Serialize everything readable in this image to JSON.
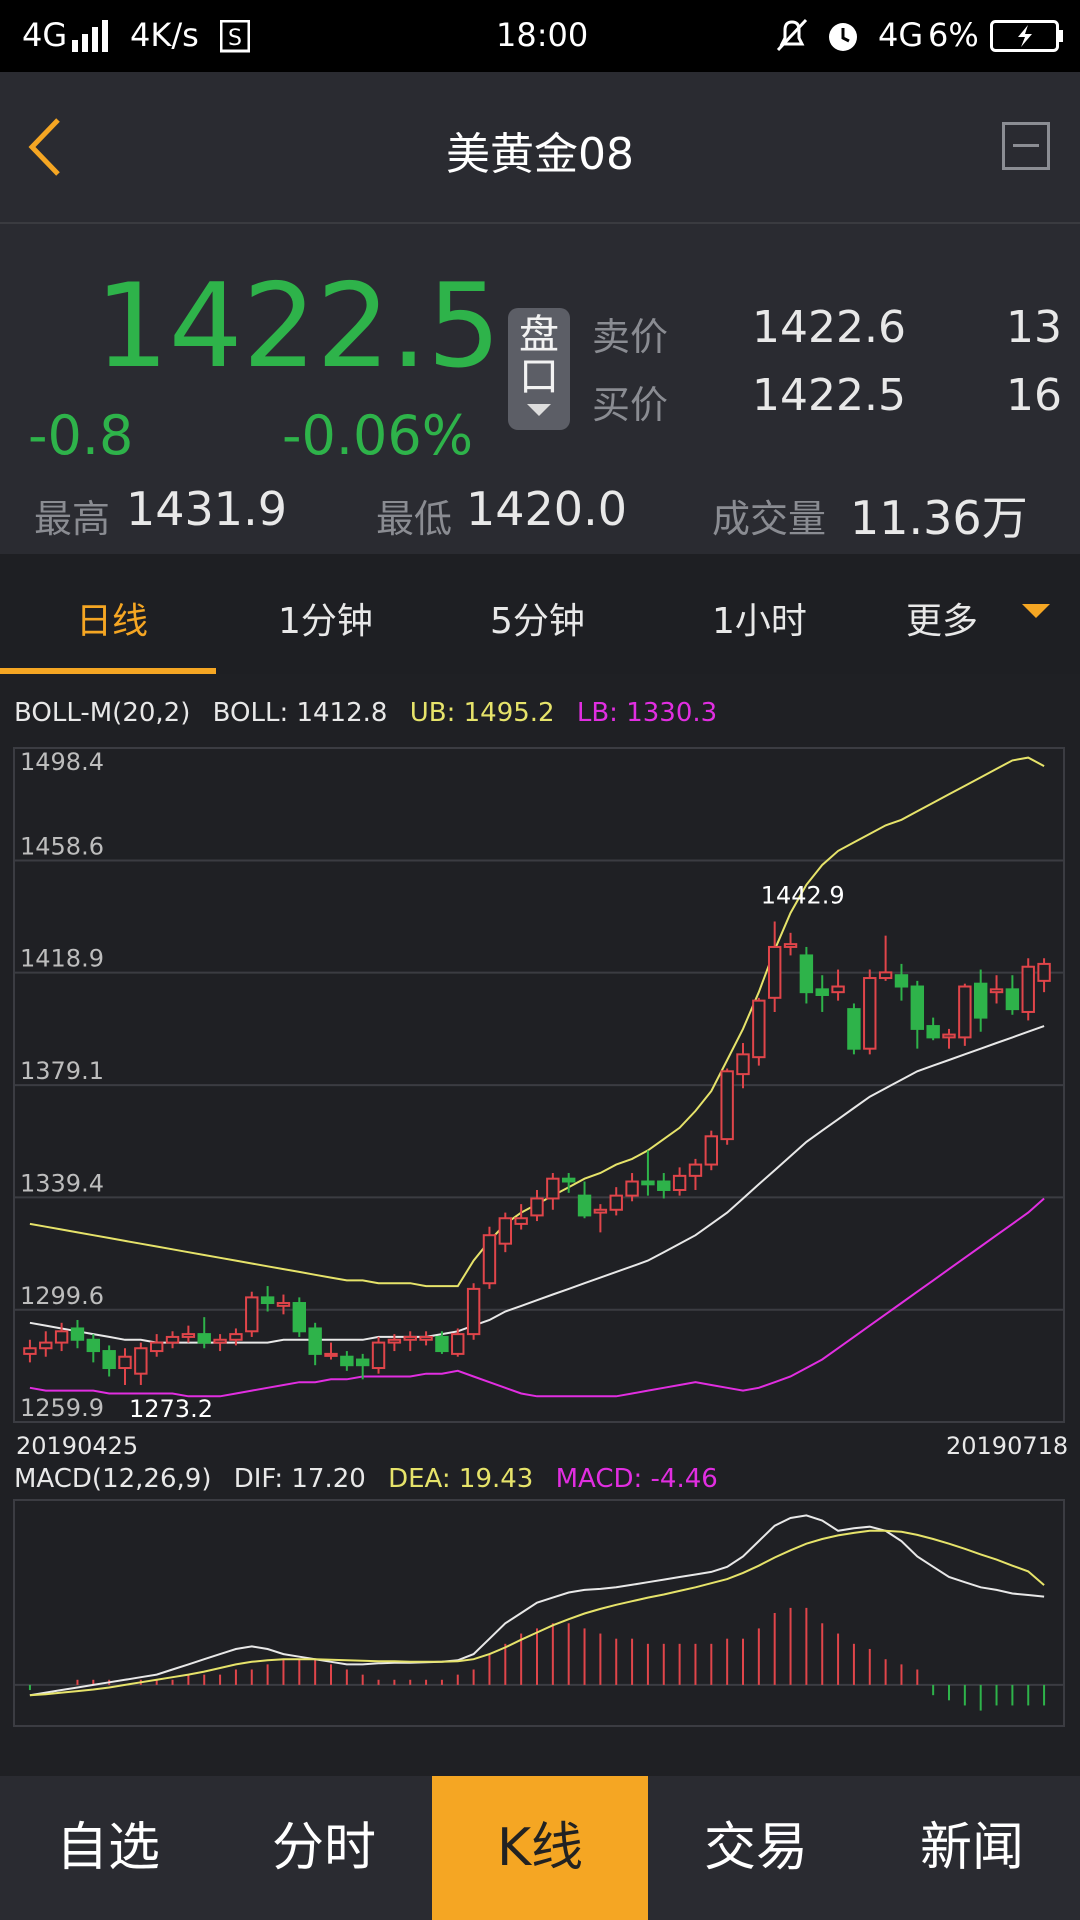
{
  "status_bar": {
    "network_left": "4G",
    "speed": "4K/s",
    "time": "18:00",
    "network_right": "4G",
    "battery": "6%"
  },
  "header": {
    "title": "美黄金08"
  },
  "quote": {
    "price": "1422.5",
    "change": "-0.8",
    "change_pct": "-0.06%",
    "pankou_label": "盘口",
    "ask_label": "卖价",
    "ask_price": "1422.6",
    "ask_vol": "13",
    "bid_label": "买价",
    "bid_price": "1422.5",
    "bid_vol": "16",
    "high_label": "最高",
    "high": "1431.9",
    "low_label": "最低",
    "low": "1420.0",
    "volume_label": "成交量",
    "volume": "11.36万"
  },
  "tabs": [
    "日线",
    "1分钟",
    "5分钟",
    "1小时",
    "更多"
  ],
  "boll": {
    "label": "BOLL-M(20,2)",
    "boll": "BOLL: 1412.8",
    "ub": "UB: 1495.2",
    "lb": "LB: 1330.3",
    "ub_color": "#e6e36a",
    "lb_color": "#e12ee1"
  },
  "macd": {
    "label": "MACD(12,26,9)",
    "dif": "DIF: 17.20",
    "dea": "DEA: 19.43",
    "macd": "MACD: -4.46"
  },
  "chart_data": {
    "type": "candlestick",
    "ylim": [
      1259.9,
      1498.4
    ],
    "yticks": [
      "1498.4",
      "1458.6",
      "1418.9",
      "1379.1",
      "1339.4",
      "1299.6",
      "1259.9"
    ],
    "x_start": "20190425",
    "x_end": "20190718",
    "high_label": "1442.9",
    "low_label": "1273.2",
    "up_color": "#e0454a",
    "down_color": "#2eb34a",
    "candles": [
      [
        1284,
        1286,
        1289,
        1281
      ],
      [
        1286,
        1288,
        1292,
        1283
      ],
      [
        1288,
        1292,
        1295,
        1285
      ],
      [
        1293,
        1289,
        1296,
        1286
      ],
      [
        1289,
        1285,
        1291,
        1281
      ],
      [
        1285,
        1279,
        1287,
        1276
      ],
      [
        1279,
        1283,
        1286,
        1273
      ],
      [
        1277,
        1286,
        1288,
        1273
      ],
      [
        1285,
        1288,
        1291,
        1283
      ],
      [
        1288,
        1290,
        1292,
        1286
      ],
      [
        1290,
        1291,
        1294,
        1288
      ],
      [
        1291,
        1288,
        1297,
        1286
      ],
      [
        1288,
        1289,
        1291,
        1285
      ],
      [
        1289,
        1291,
        1293,
        1287
      ],
      [
        1292,
        1304,
        1306,
        1290
      ],
      [
        1304,
        1302,
        1308,
        1299
      ],
      [
        1301,
        1302,
        1305,
        1298
      ],
      [
        1302,
        1292,
        1304,
        1290
      ],
      [
        1293,
        1284,
        1295,
        1280
      ],
      [
        1284,
        1284,
        1288,
        1282
      ],
      [
        1283,
        1280,
        1285,
        1278
      ],
      [
        1282,
        1280,
        1284,
        1275
      ],
      [
        1279,
        1288,
        1290,
        1277
      ],
      [
        1288,
        1289,
        1291,
        1285
      ],
      [
        1289,
        1290,
        1292,
        1285
      ],
      [
        1289,
        1290,
        1292,
        1287
      ],
      [
        1290,
        1285,
        1292,
        1284
      ],
      [
        1284,
        1291,
        1293,
        1283
      ],
      [
        1291,
        1307,
        1309,
        1289
      ],
      [
        1309,
        1326,
        1329,
        1307
      ],
      [
        1323,
        1332,
        1334,
        1320
      ],
      [
        1330,
        1332,
        1337,
        1328
      ],
      [
        1333,
        1339,
        1342,
        1331
      ],
      [
        1339,
        1346,
        1348,
        1335
      ],
      [
        1346,
        1345,
        1348,
        1341
      ],
      [
        1340,
        1333,
        1345,
        1332
      ],
      [
        1334,
        1335,
        1337,
        1327
      ],
      [
        1335,
        1340,
        1343,
        1333
      ],
      [
        1340,
        1345,
        1348,
        1338
      ],
      [
        1345,
        1344,
        1356,
        1340
      ],
      [
        1345,
        1342,
        1348,
        1339
      ],
      [
        1342,
        1347,
        1350,
        1340
      ],
      [
        1347,
        1351,
        1353,
        1342
      ],
      [
        1351,
        1361,
        1363,
        1349
      ],
      [
        1360,
        1384,
        1385,
        1358
      ],
      [
        1383,
        1390,
        1394,
        1378
      ],
      [
        1389,
        1409,
        1410,
        1386
      ],
      [
        1410,
        1428,
        1437,
        1405
      ],
      [
        1428,
        1429,
        1433,
        1425
      ],
      [
        1425,
        1412,
        1428,
        1408
      ],
      [
        1413,
        1411,
        1418,
        1405
      ],
      [
        1412,
        1414,
        1420,
        1409
      ],
      [
        1406,
        1392,
        1408,
        1390
      ],
      [
        1392,
        1417,
        1420,
        1390
      ],
      [
        1417,
        1419,
        1432,
        1416
      ],
      [
        1418,
        1414,
        1422,
        1409
      ],
      [
        1414,
        1399,
        1416,
        1392
      ],
      [
        1400,
        1396,
        1403,
        1395
      ],
      [
        1396,
        1397,
        1399,
        1392
      ],
      [
        1396,
        1414,
        1415,
        1393
      ],
      [
        1415,
        1403,
        1420,
        1398
      ],
      [
        1412,
        1413,
        1418,
        1408
      ],
      [
        1413,
        1406,
        1418,
        1404
      ],
      [
        1405,
        1421,
        1424,
        1402
      ],
      [
        1416,
        1422,
        1424,
        1412
      ]
    ],
    "boll_mid": [
      1295,
      1294,
      1293,
      1292,
      1291,
      1290,
      1289,
      1289,
      1288,
      1288,
      1288,
      1288,
      1288,
      1288,
      1288,
      1288,
      1289,
      1289,
      1289,
      1289,
      1289,
      1289,
      1290,
      1290,
      1290,
      1290,
      1291,
      1292,
      1294,
      1296,
      1299,
      1301,
      1303,
      1305,
      1307,
      1309,
      1311,
      1313,
      1315,
      1317,
      1320,
      1323,
      1326,
      1330,
      1334,
      1339,
      1344,
      1349,
      1354,
      1359,
      1363,
      1367,
      1371,
      1375,
      1378,
      1381,
      1384,
      1386,
      1388,
      1390,
      1392,
      1394,
      1396,
      1398,
      1400
    ],
    "boll_ub": [
      1330,
      1329,
      1328,
      1327,
      1326,
      1325,
      1324,
      1323,
      1322,
      1321,
      1320,
      1319,
      1318,
      1317,
      1316,
      1315,
      1314,
      1313,
      1312,
      1311,
      1310,
      1310,
      1309,
      1309,
      1309,
      1308,
      1308,
      1308,
      1317,
      1324,
      1330,
      1334,
      1337,
      1340,
      1343,
      1346,
      1348,
      1351,
      1353,
      1356,
      1360,
      1364,
      1370,
      1377,
      1388,
      1399,
      1412,
      1427,
      1440,
      1450,
      1457,
      1462,
      1465,
      1468,
      1471,
      1473,
      1476,
      1479,
      1482,
      1485,
      1488,
      1491,
      1494,
      1495,
      1492
    ],
    "boll_lb": [
      1272,
      1271,
      1271,
      1271,
      1271,
      1270,
      1270,
      1270,
      1270,
      1270,
      1269,
      1269,
      1269,
      1270,
      1271,
      1272,
      1273,
      1274,
      1274,
      1275,
      1275,
      1276,
      1276,
      1276,
      1276,
      1277,
      1277,
      1278,
      1276,
      1274,
      1272,
      1270,
      1269,
      1269,
      1269,
      1269,
      1269,
      1269,
      1270,
      1271,
      1272,
      1273,
      1274,
      1273,
      1272,
      1271,
      1272,
      1274,
      1276,
      1279,
      1282,
      1286,
      1290,
      1294,
      1298,
      1302,
      1306,
      1310,
      1314,
      1318,
      1322,
      1326,
      1330,
      1334,
      1339
    ],
    "macd_ylim": [
      -8,
      36
    ],
    "macd_hist": [
      -1,
      0,
      0,
      1,
      1,
      1,
      0,
      1,
      1,
      1,
      2,
      2,
      2,
      3,
      3,
      4,
      5,
      5,
      5,
      4,
      3,
      2,
      1,
      1,
      1,
      1,
      1,
      2,
      3,
      6,
      8,
      10,
      11,
      12,
      12,
      11,
      10,
      9,
      9,
      8,
      8,
      8,
      8,
      8,
      9,
      9,
      11,
      14,
      15,
      15,
      12,
      10,
      8,
      7,
      5,
      4,
      3,
      -2,
      -3,
      -4,
      -5,
      -4,
      -4,
      -4,
      -4
    ],
    "macd_dif": [
      -2,
      -1.5,
      -1,
      -0.5,
      0,
      0.5,
      1,
      1.5,
      2,
      3,
      4,
      5,
      6,
      7,
      7.5,
      7,
      6,
      5.5,
      5,
      4.5,
      4,
      4,
      4.2,
      4.3,
      4.3,
      4.4,
      4.5,
      4.8,
      6,
      9,
      12,
      14,
      16,
      17,
      18,
      18.5,
      18.7,
      19,
      19.5,
      20,
      20.5,
      21,
      21.5,
      22,
      23,
      25,
      28,
      31,
      32.5,
      33,
      32,
      30,
      30.5,
      30.8,
      30,
      28,
      25,
      23,
      21,
      20,
      19,
      18.5,
      17.8,
      17.5,
      17.2
    ],
    "macd_dea": [
      -2,
      -1.8,
      -1.5,
      -1.2,
      -0.9,
      -0.5,
      0,
      0.5,
      1,
      1.5,
      2,
      2.6,
      3.3,
      4,
      4.5,
      4.8,
      5,
      5,
      5,
      4.9,
      4.8,
      4.7,
      4.6,
      4.6,
      4.5,
      4.5,
      4.5,
      4.6,
      5,
      6,
      7.3,
      8.8,
      10.2,
      11.6,
      12.8,
      13.9,
      14.8,
      15.6,
      16.3,
      17,
      17.6,
      18.3,
      19,
      19.8,
      20.6,
      21.8,
      23.2,
      24.8,
      26.2,
      27.5,
      28.4,
      29.1,
      29.6,
      30,
      30,
      29.8,
      29.2,
      28.4,
      27.5,
      26.5,
      25.4,
      24.4,
      23.2,
      22.1,
      19.43
    ]
  },
  "nav": [
    "自选",
    "分时",
    "K线",
    "交易",
    "新闻"
  ]
}
